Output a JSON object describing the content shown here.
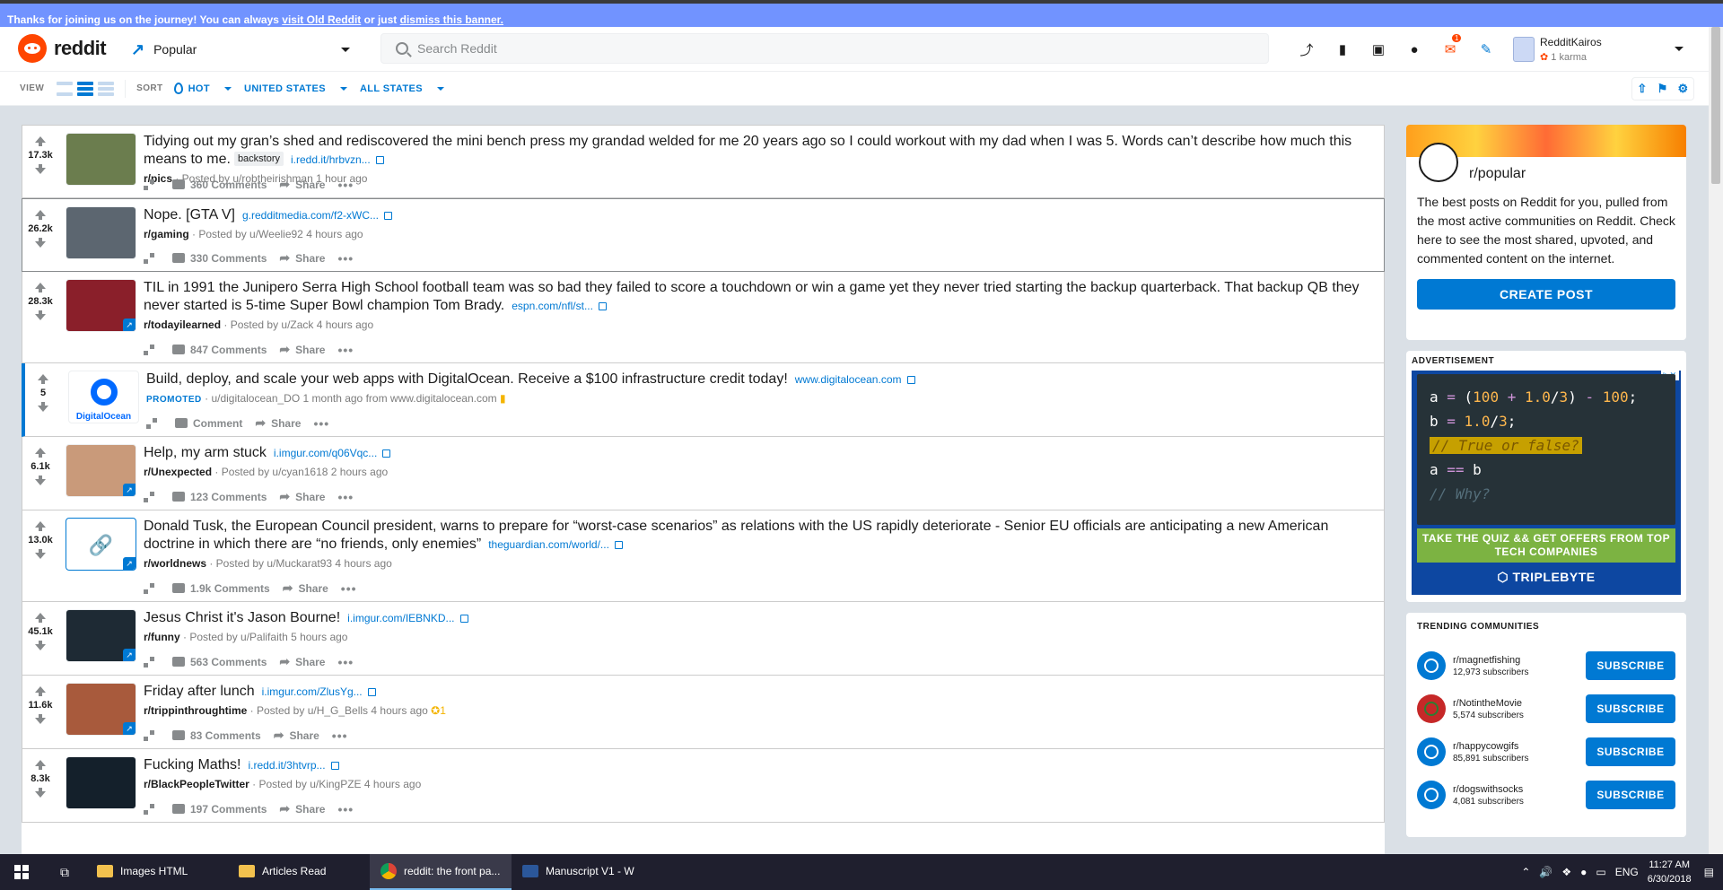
{
  "banner": {
    "prefix": "Thanks for joining us on the journey! You can always ",
    "link1": "visit Old Reddit",
    "mid": " or just ",
    "link2": "dismiss this banner."
  },
  "header": {
    "logo_text": "reddit",
    "feed": "Popular",
    "search_placeholder": "Search Reddit",
    "icons": [
      "trending-icon",
      "stats-icon",
      "cc-icon",
      "chat-icon",
      "mail-icon",
      "pencil-icon"
    ],
    "mail_count": "1",
    "username": "RedditKairos",
    "karma": "1 karma"
  },
  "sortbar": {
    "view_label": "VIEW",
    "sort_label": "SORT",
    "hot": "HOT",
    "country": "UNITED STATES",
    "states": "ALL STATES"
  },
  "posts": [
    {
      "score": "17.3k",
      "title": "Tidying out my gran’s shed and rediscovered the mini bench press my grandad welded for me 20 years ago so I could workout with my dad when I was 5. Words can’t describe how much this means to me.",
      "flair": "backstory",
      "domain": "i.redd.it/hrbvzn...",
      "sub": "r/pics",
      "by": " · Posted by u/robtheirishman ",
      "time": "1 hour ago",
      "comments": "360 Comments",
      "thumb": "#6b7d4e"
    },
    {
      "score": "26.2k",
      "title": "Nope. [GTA V]",
      "flair": "",
      "domain": "g.redditmedia.com/f2-xWC...",
      "sub": "r/gaming",
      "by": " · Posted by u/Weelie92 ",
      "time": "4 hours ago",
      "comments": "330 Comments",
      "thumb": "#5c6670"
    },
    {
      "score": "28.3k",
      "title": "TIL in 1991 the Junipero Serra High School football team was so bad they failed to score a touchdown or win a game yet they never tried starting the backup quarterback. That backup QB they never started is 5-time Super Bowl champion Tom Brady.",
      "flair": "",
      "domain": "espn.com/nfl/st...",
      "sub": "r/todayilearned",
      "by": " · Posted by u/Zack ",
      "time": "4 hours ago",
      "comments": "847 Comments",
      "thumb": "#8a1f2a"
    },
    {
      "score": "5",
      "title": "Build, deploy, and scale your web apps with DigitalOcean. Receive a $100 infrastructure credit today!",
      "flair": "",
      "domain": "www.digitalocean.com",
      "sub": "PROMOTED",
      "by": " · u/digitalocean_DO ",
      "time": "1 month ago from www.digitalocean.com",
      "comments": "Comment",
      "thumb": "#ffffff",
      "thumb_text": "DigitalOcean"
    },
    {
      "score": "6.1k",
      "title": "Help, my arm stuck",
      "flair": "",
      "domain": "i.imgur.com/q06Vqc...",
      "sub": "r/Unexpected",
      "by": " · Posted by u/cyan1618 ",
      "time": "2 hours ago",
      "comments": "123 Comments",
      "thumb": "#c99a7a"
    },
    {
      "score": "13.0k",
      "title": "Donald Tusk, the European Council president, warns to prepare for “worst-case scenarios” as relations with the US rapidly deteriorate - Senior EU officials are anticipating a new American doctrine in which there are “no friends, only enemies”",
      "flair": "",
      "domain": "theguardian.com/world/...",
      "sub": "r/worldnews",
      "by": " · Posted by u/Muckarat93 ",
      "time": "4 hours ago",
      "comments": "1.9k Comments",
      "thumb": "#ffffff"
    },
    {
      "score": "45.1k",
      "title": "Jesus Christ it's Jason Bourne!",
      "flair": "",
      "domain": "i.imgur.com/IEBNKD...",
      "sub": "r/funny",
      "by": " · Posted by u/Palifaith ",
      "time": "5 hours ago",
      "comments": "563 Comments",
      "thumb": "#1e2a34"
    },
    {
      "score": "11.6k",
      "title": "Friday after lunch",
      "flair": "",
      "domain": "i.imgur.com/ZlusYg...",
      "sub": "r/trippinthroughtime",
      "by": " · Posted by u/H_G_Bells ",
      "time": "4 hours ago",
      "extra": "1",
      "comments": "83 Comments",
      "thumb": "#a85a3c"
    },
    {
      "score": "8.3k",
      "title": "Fucking Maths!",
      "flair": "",
      "domain": "i.redd.it/3htvrp...",
      "sub": "r/BlackPeopleTwitter",
      "by": " · Posted by u/KingPZE ",
      "time": "4 hours ago",
      "comments": "197 Comments",
      "thumb": "#14202b"
    }
  ],
  "actions": {
    "share": "Share"
  },
  "sidebar": {
    "popular_name": "r/popular",
    "popular_desc": "The best posts on Reddit for you, pulled from the most active communities on Reddit. Check here to see the most shared, upvoted, and commented content on the internet.",
    "create_post": "CREATE POST",
    "ad_label": "ADVERTISEMENT",
    "ad_cta": "TAKE THE QUIZ && GET OFFERS FROM TOP TECH COMPANIES",
    "ad_brand": "TRIPLEBYTE",
    "trending_label": "TRENDING COMMUNITIES",
    "communities": [
      {
        "name": "r/magnetfishing",
        "subs": "12,973 subscribers"
      },
      {
        "name": "r/NotintheMovie",
        "subs": "5,574 subscribers"
      },
      {
        "name": "r/happycowgifs",
        "subs": "85,891 subscribers"
      },
      {
        "name": "r/dogswithsocks",
        "subs": "4,081 subscribers"
      }
    ],
    "subscribe": "SUBSCRIBE"
  },
  "taskbar": {
    "items": [
      "Images HTML",
      "Articles Read",
      "reddit: the front pa...",
      "Manuscript V1 - W"
    ],
    "lang": "ENG",
    "time": "11:27 AM",
    "date": "6/30/2018"
  }
}
